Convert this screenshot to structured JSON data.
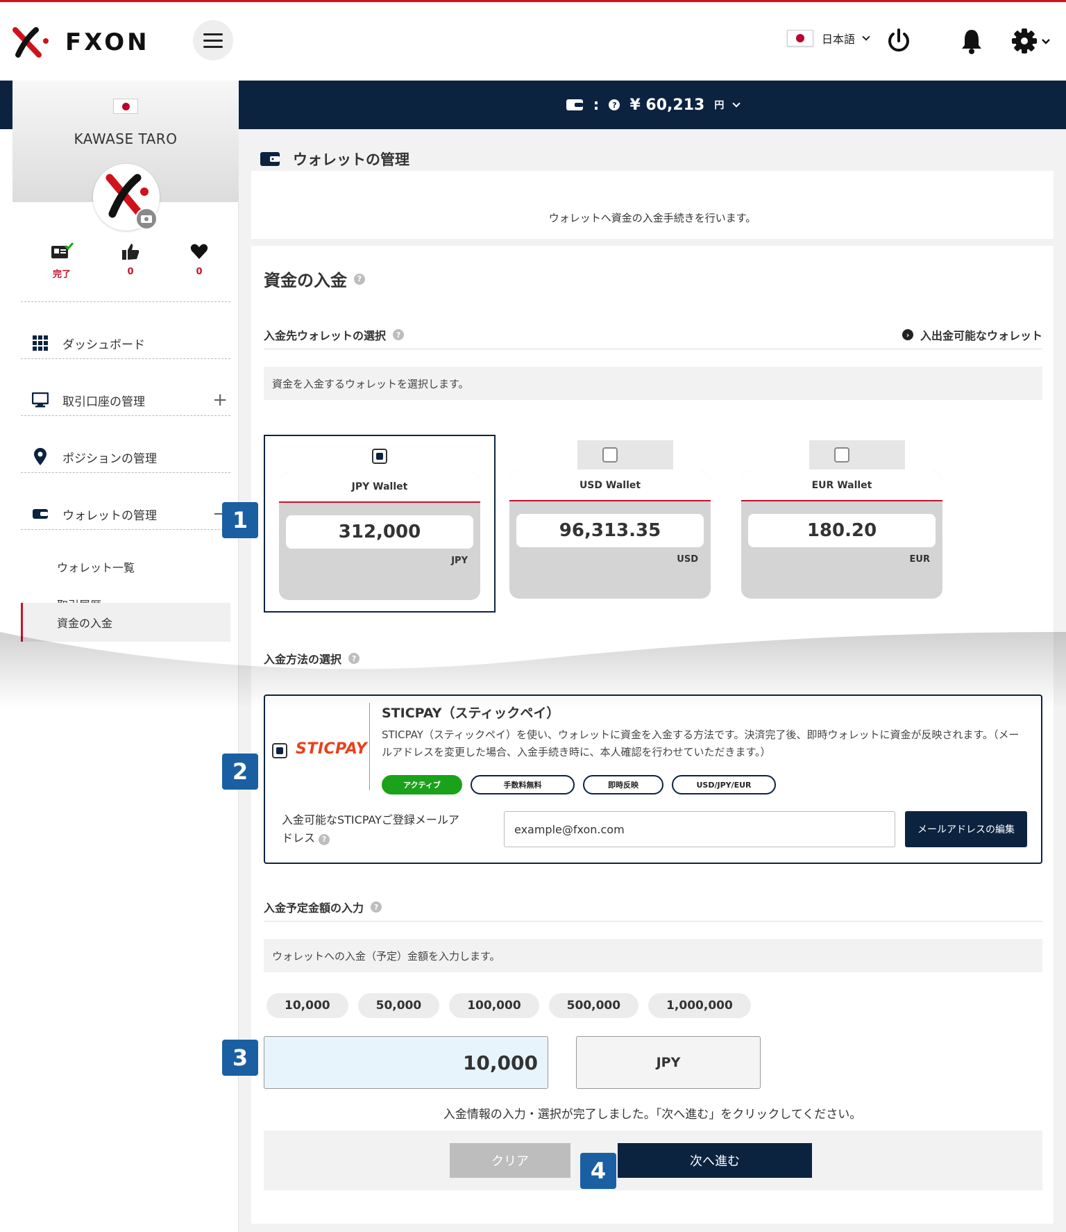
{
  "header": {
    "logo_text": "FXON",
    "language": "日本語"
  },
  "balance_bar": {
    "value": "¥ 60,213",
    "unit": "円"
  },
  "profile": {
    "name": "KAWASE TARO",
    "stats": [
      {
        "icon": "id-card-check-icon",
        "value": "完了"
      },
      {
        "icon": "thumbs-up-icon",
        "value": "0"
      },
      {
        "icon": "heart-icon",
        "value": "0"
      }
    ]
  },
  "sidebar": {
    "items": [
      {
        "label": "ダッシュボード",
        "icon": "grid-icon"
      },
      {
        "label": "取引口座の管理",
        "icon": "monitor-icon",
        "action": "+"
      },
      {
        "label": "ポジションの管理",
        "icon": "map-pin-icon"
      },
      {
        "label": "ウォレットの管理",
        "icon": "wallet-icon",
        "action": "−"
      }
    ],
    "subitems": [
      {
        "label": "ウォレット一覧"
      },
      {
        "label": "取引履歴"
      },
      {
        "label": "資金の入金"
      }
    ]
  },
  "page": {
    "title": "ウォレットの管理",
    "info": "ウォレットへ資金の入金手続きを行います。"
  },
  "deposit": {
    "heading": "資金の入金",
    "wallet_section": {
      "title": "入金先ウォレットの選択",
      "link": "入出金可能なウォレット",
      "hint": "資金を入金するウォレットを選択します。",
      "wallets": [
        {
          "name": "JPY Wallet",
          "value": "312,000",
          "currency": "JPY",
          "selected": true
        },
        {
          "name": "USD Wallet",
          "value": "96,313.35",
          "currency": "USD",
          "selected": false
        },
        {
          "name": "EUR Wallet",
          "value": "180.20",
          "currency": "EUR",
          "selected": false
        }
      ]
    },
    "method_section": {
      "title": "入金方法の選択",
      "brand": "STICPAY",
      "method_title": "STICPAY（スティックペイ）",
      "method_desc": "STICPAY（スティックペイ）を使い、ウォレットに資金を入金する方法です。決済完了後、即時ウォレットに資金が反映されます。（メールアドレスを変更した場合、入金手続き時に、本人確認を行わせていただきます。）",
      "tags": [
        "アクティブ",
        "手数料無料",
        "即時反映",
        "USD/JPY/EUR"
      ],
      "email_label": "入金可能なSTICPAYご登録メールアドレス",
      "email_value": "example@fxon.com",
      "edit_button": "メールアドレスの編集"
    },
    "amount_section": {
      "title": "入金予定金額の入力",
      "hint": "ウォレットへの入金（予定）金額を入力します。",
      "presets": [
        "10,000",
        "50,000",
        "100,000",
        "500,000",
        "1,000,000"
      ],
      "amount_value": "10,000",
      "currency": "JPY",
      "done_message": "入金情報の入力・選択が完了しました。「次へ進む」をクリックしてください。"
    },
    "buttons": {
      "clear": "クリア",
      "next": "次へ進む"
    }
  },
  "steps": [
    "1",
    "2",
    "3",
    "4"
  ],
  "colors": {
    "navy": "#0c2340",
    "red": "#c8102e",
    "badge_blue": "#1b5fa3",
    "active_green": "#1aa21a",
    "sticpay_orange": "#e8401c"
  }
}
